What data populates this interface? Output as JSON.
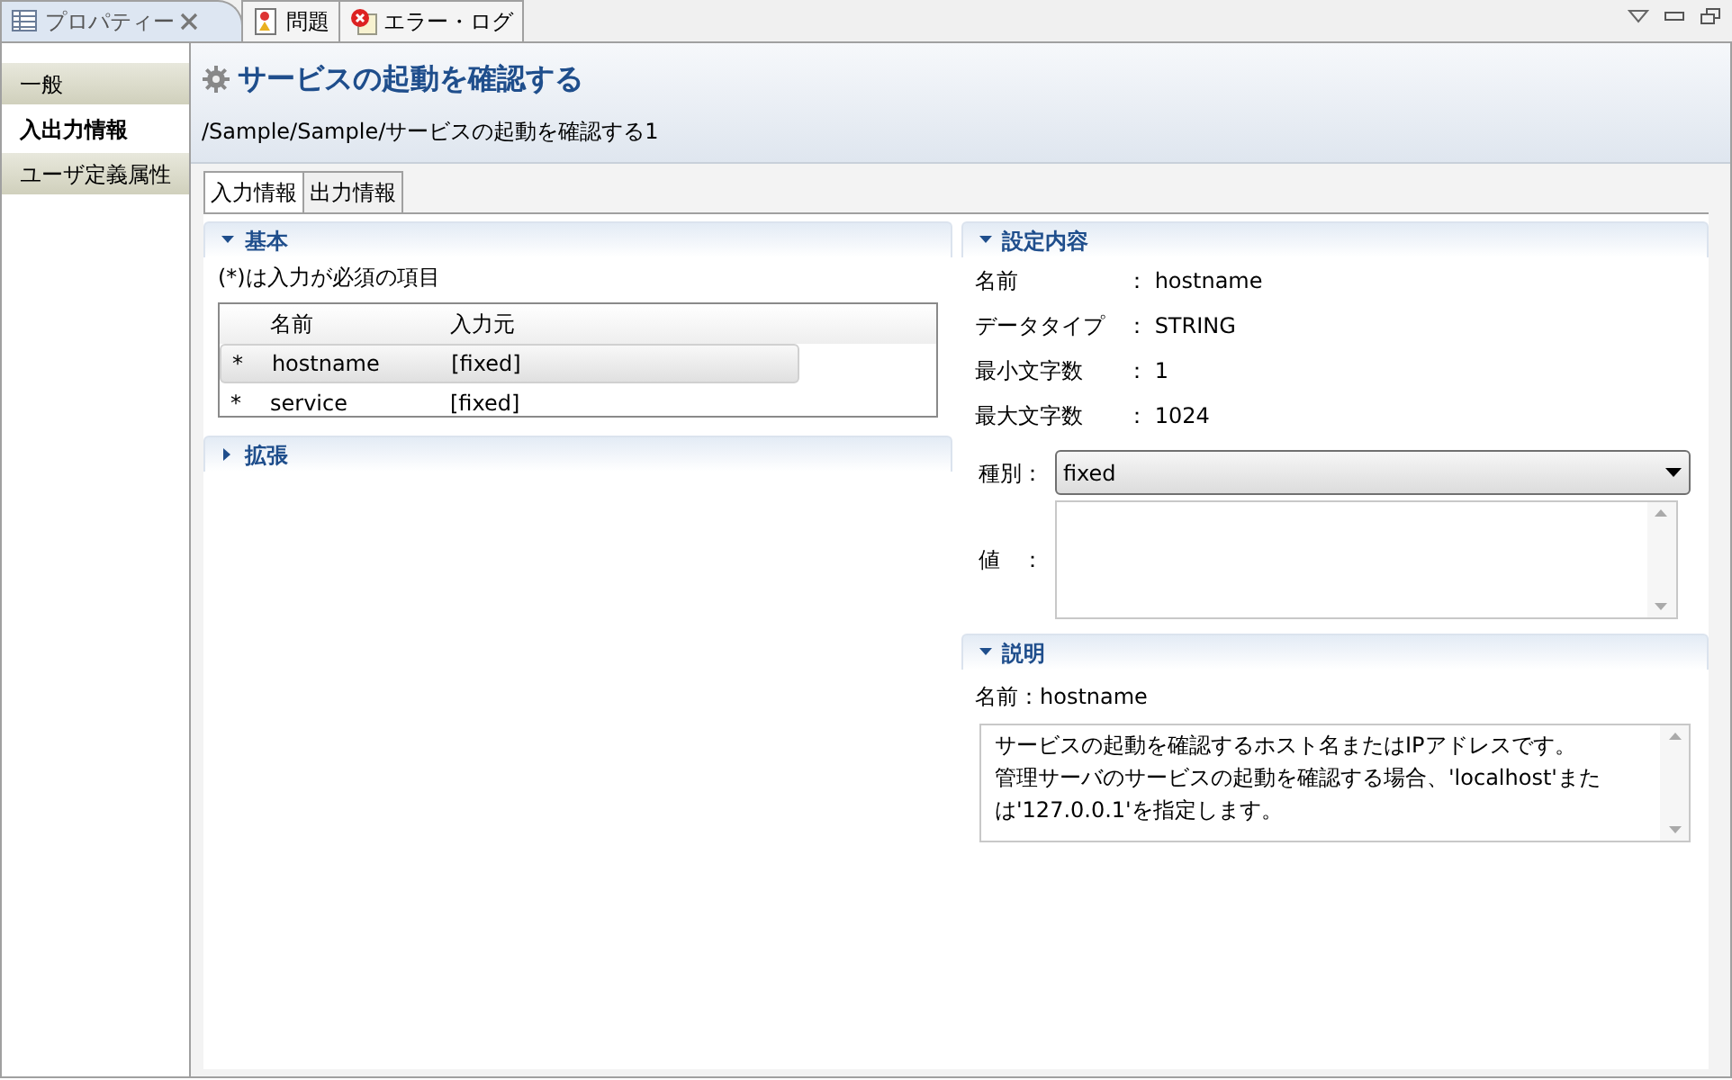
{
  "view_tabs": [
    {
      "label": "プロパティー",
      "kind": "properties",
      "selected": true,
      "closable": true
    },
    {
      "label": "問題",
      "kind": "problems",
      "selected": false,
      "closable": false
    },
    {
      "label": "エラー・ログ",
      "kind": "errorlog",
      "selected": false,
      "closable": false
    }
  ],
  "sidebar": {
    "items": [
      {
        "label": "一般",
        "selected": false
      },
      {
        "label": "入出力情報",
        "selected": true
      },
      {
        "label": "ユーザ定義属性",
        "selected": false
      }
    ]
  },
  "header": {
    "title": "サービスの起動を確認する",
    "path": "/Sample/Sample/サービスの起動を確認する1"
  },
  "sub_tabs": [
    {
      "label": "入力情報",
      "selected": true
    },
    {
      "label": "出力情報",
      "selected": false
    }
  ],
  "basic_section": {
    "title": "基本",
    "expanded": true,
    "note": "(*)は入力が必須の項目",
    "table": {
      "columns": [
        "名前",
        "入力元"
      ],
      "rows": [
        {
          "required": "*",
          "name": "hostname",
          "source": "[fixed]",
          "selected": true
        },
        {
          "required": "*",
          "name": "service",
          "source": "[fixed]",
          "selected": false
        }
      ]
    }
  },
  "extension_section": {
    "title": "拡張",
    "expanded": false
  },
  "settings_section": {
    "title": "設定内容",
    "expanded": true,
    "properties": [
      {
        "label": "名前",
        "value": "： hostname"
      },
      {
        "label": "データタイプ",
        "value": "： STRING"
      },
      {
        "label": "最小文字数",
        "value": "： 1"
      },
      {
        "label": "最大文字数",
        "value": "： 1024"
      }
    ],
    "type_label": "種別：",
    "type_value": "fixed",
    "value_label": "値　："
  },
  "description_section": {
    "title": "説明",
    "expanded": true,
    "name": "名前：hostname",
    "lines": [
      "サービスの起動を確認するホスト名またはIPアドレスです。",
      "管理サーバのサービスの起動を確認する場合、'localhost'また",
      "は'127.0.0.1'を指定します。"
    ]
  }
}
